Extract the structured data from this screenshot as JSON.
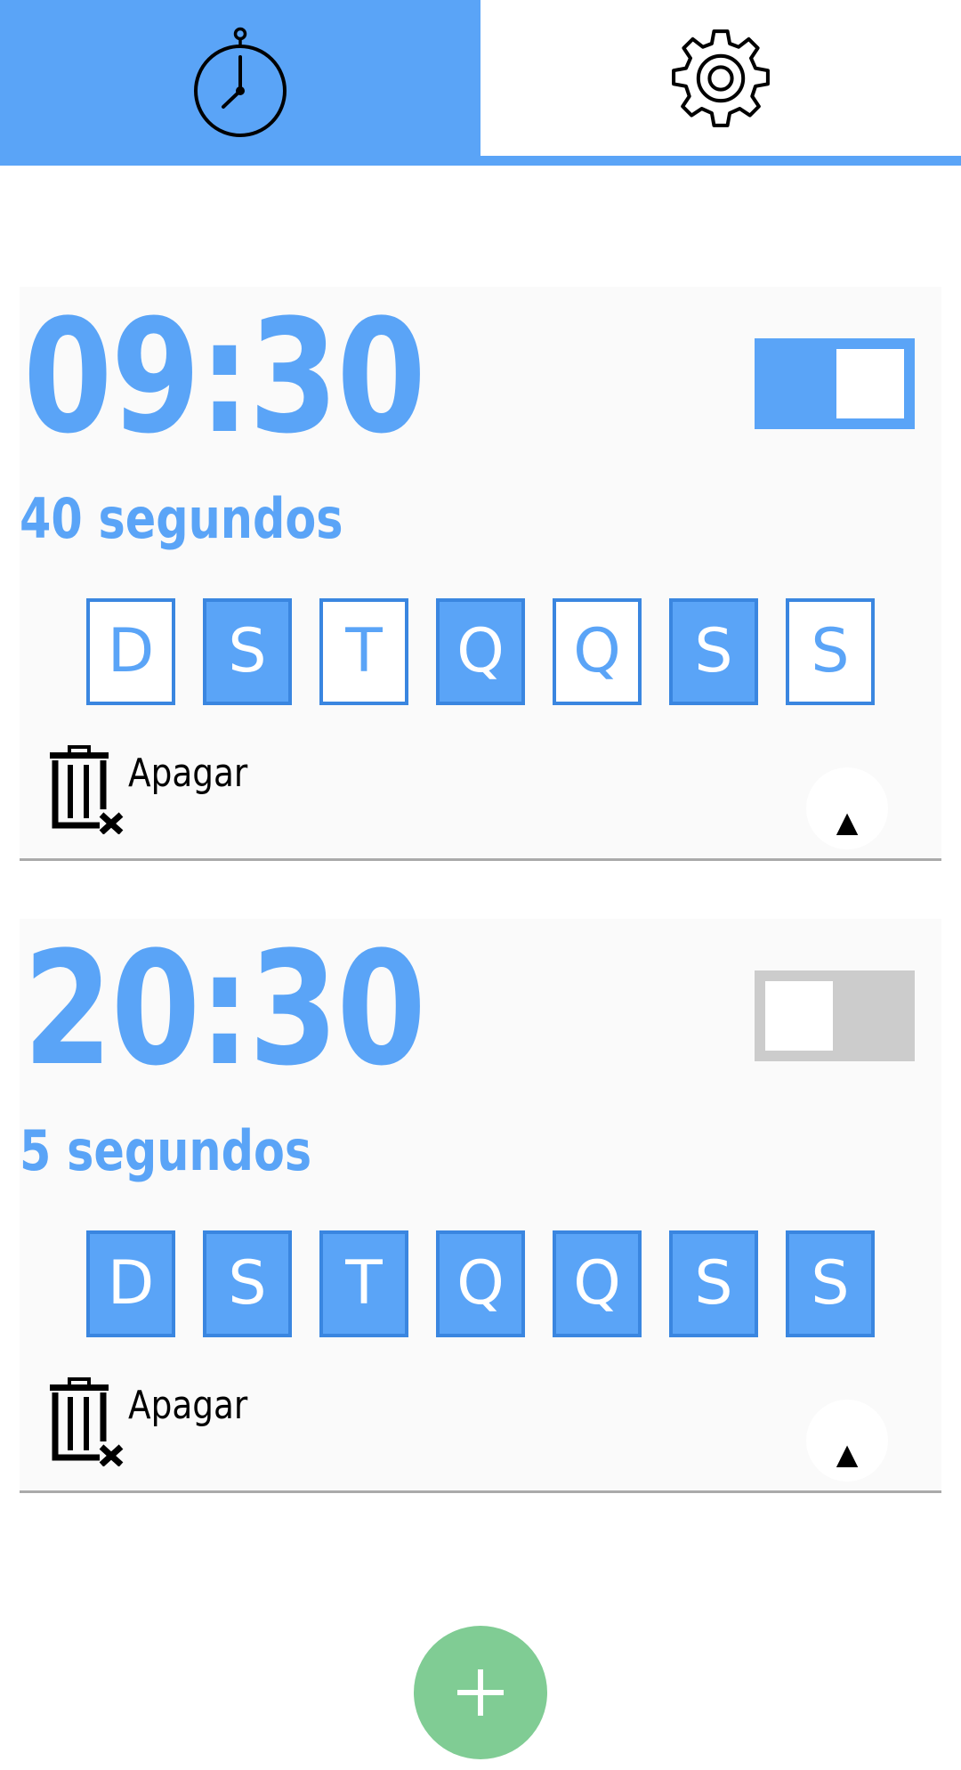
{
  "tabs": {
    "timer": {
      "icon": "stopwatch-icon",
      "active": true
    },
    "settings": {
      "icon": "gear-icon",
      "active": false
    }
  },
  "colors": {
    "accent": "#5aa4f7",
    "accent_border": "#3a86e0",
    "toggle_off": "#cccccc",
    "fab": "#80cc94",
    "card_bg": "#fafafa"
  },
  "alarms": [
    {
      "time": "09:30",
      "enabled": true,
      "duration": "40 segundos",
      "days": [
        {
          "label": "D",
          "selected": false
        },
        {
          "label": "S",
          "selected": true
        },
        {
          "label": "T",
          "selected": false
        },
        {
          "label": "Q",
          "selected": true
        },
        {
          "label": "Q",
          "selected": false
        },
        {
          "label": "S",
          "selected": true
        },
        {
          "label": "S",
          "selected": false
        }
      ],
      "delete_label": "Apagar",
      "delete_icon": "trash-delete-icon",
      "expand_glyph": "▲"
    },
    {
      "time": "20:30",
      "enabled": false,
      "duration": "5 segundos",
      "days": [
        {
          "label": "D",
          "selected": true
        },
        {
          "label": "S",
          "selected": true
        },
        {
          "label": "T",
          "selected": true
        },
        {
          "label": "Q",
          "selected": true
        },
        {
          "label": "Q",
          "selected": true
        },
        {
          "label": "S",
          "selected": true
        },
        {
          "label": "S",
          "selected": true
        }
      ],
      "delete_label": "Apagar",
      "delete_icon": "trash-delete-icon",
      "expand_glyph": "▲"
    }
  ],
  "fab": {
    "icon": "plus-icon"
  }
}
